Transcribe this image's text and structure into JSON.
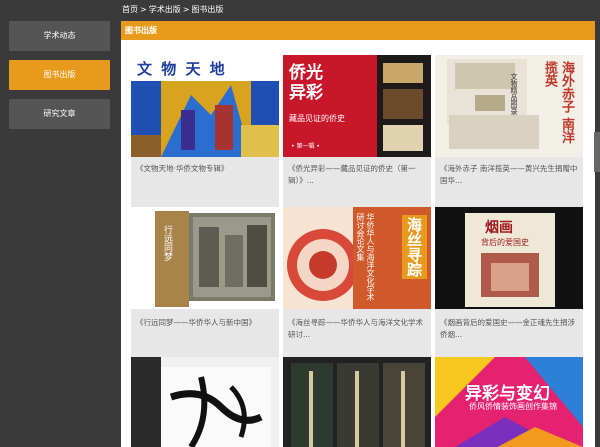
{
  "sidebar": {
    "items": [
      {
        "label": "学术动态"
      },
      {
        "label": "图书出版"
      },
      {
        "label": "研究文章"
      }
    ]
  },
  "breadcrumb": [
    "首页",
    "学术出版",
    "图书出版"
  ],
  "section": {
    "title": "图书出版"
  },
  "books": [
    {
      "caption": "《文物天地·华侨文物专辑》",
      "cover_text": "文 物 天 地",
      "cover_color": "#1f4fb3"
    },
    {
      "caption": "《侨光异彩——藏品见证的侨史（第一辑）》...",
      "cover_text": "侨光异彩",
      "cover_sub": "藏品见证的侨史",
      "cover_sub2": "• 第一辑 •",
      "cover_color": "#c8162a"
    },
    {
      "caption": "《海外赤子 南洋揽英——黄兴先生捐赠中国华...",
      "cover_text": "海外赤子 南洋揽英",
      "cover_sub": "文物精品图录",
      "cover_color": "#c0392b"
    },
    {
      "caption": "《行远同梦——华侨华人与新中国》",
      "cover_text": "行远同梦",
      "cover_color": "#b89b5c"
    },
    {
      "caption": "《海丝寻踪——华侨华人与海洋文化学术研讨...",
      "cover_text": "海丝寻踪",
      "cover_sub": "华侨华人与海洋文化学术研讨会论文集",
      "cover_color": "#d05a2b"
    },
    {
      "caption": "《烟画背后的爱国史——金正魂先生捐涉侨烟...",
      "cover_text": "烟画",
      "cover_sub": "背后的爱国史",
      "cover_color": "#a01a20"
    },
    {
      "caption": "",
      "cover_text": "",
      "cover_color": "#eeeeee"
    },
    {
      "caption": "",
      "cover_text": "",
      "cover_color": "#2e3a2e"
    },
    {
      "caption": "",
      "cover_text": "异彩与变幻",
      "cover_sub": "侨风侨情装饰画创作集锦",
      "cover_color": "#e4226f"
    }
  ]
}
